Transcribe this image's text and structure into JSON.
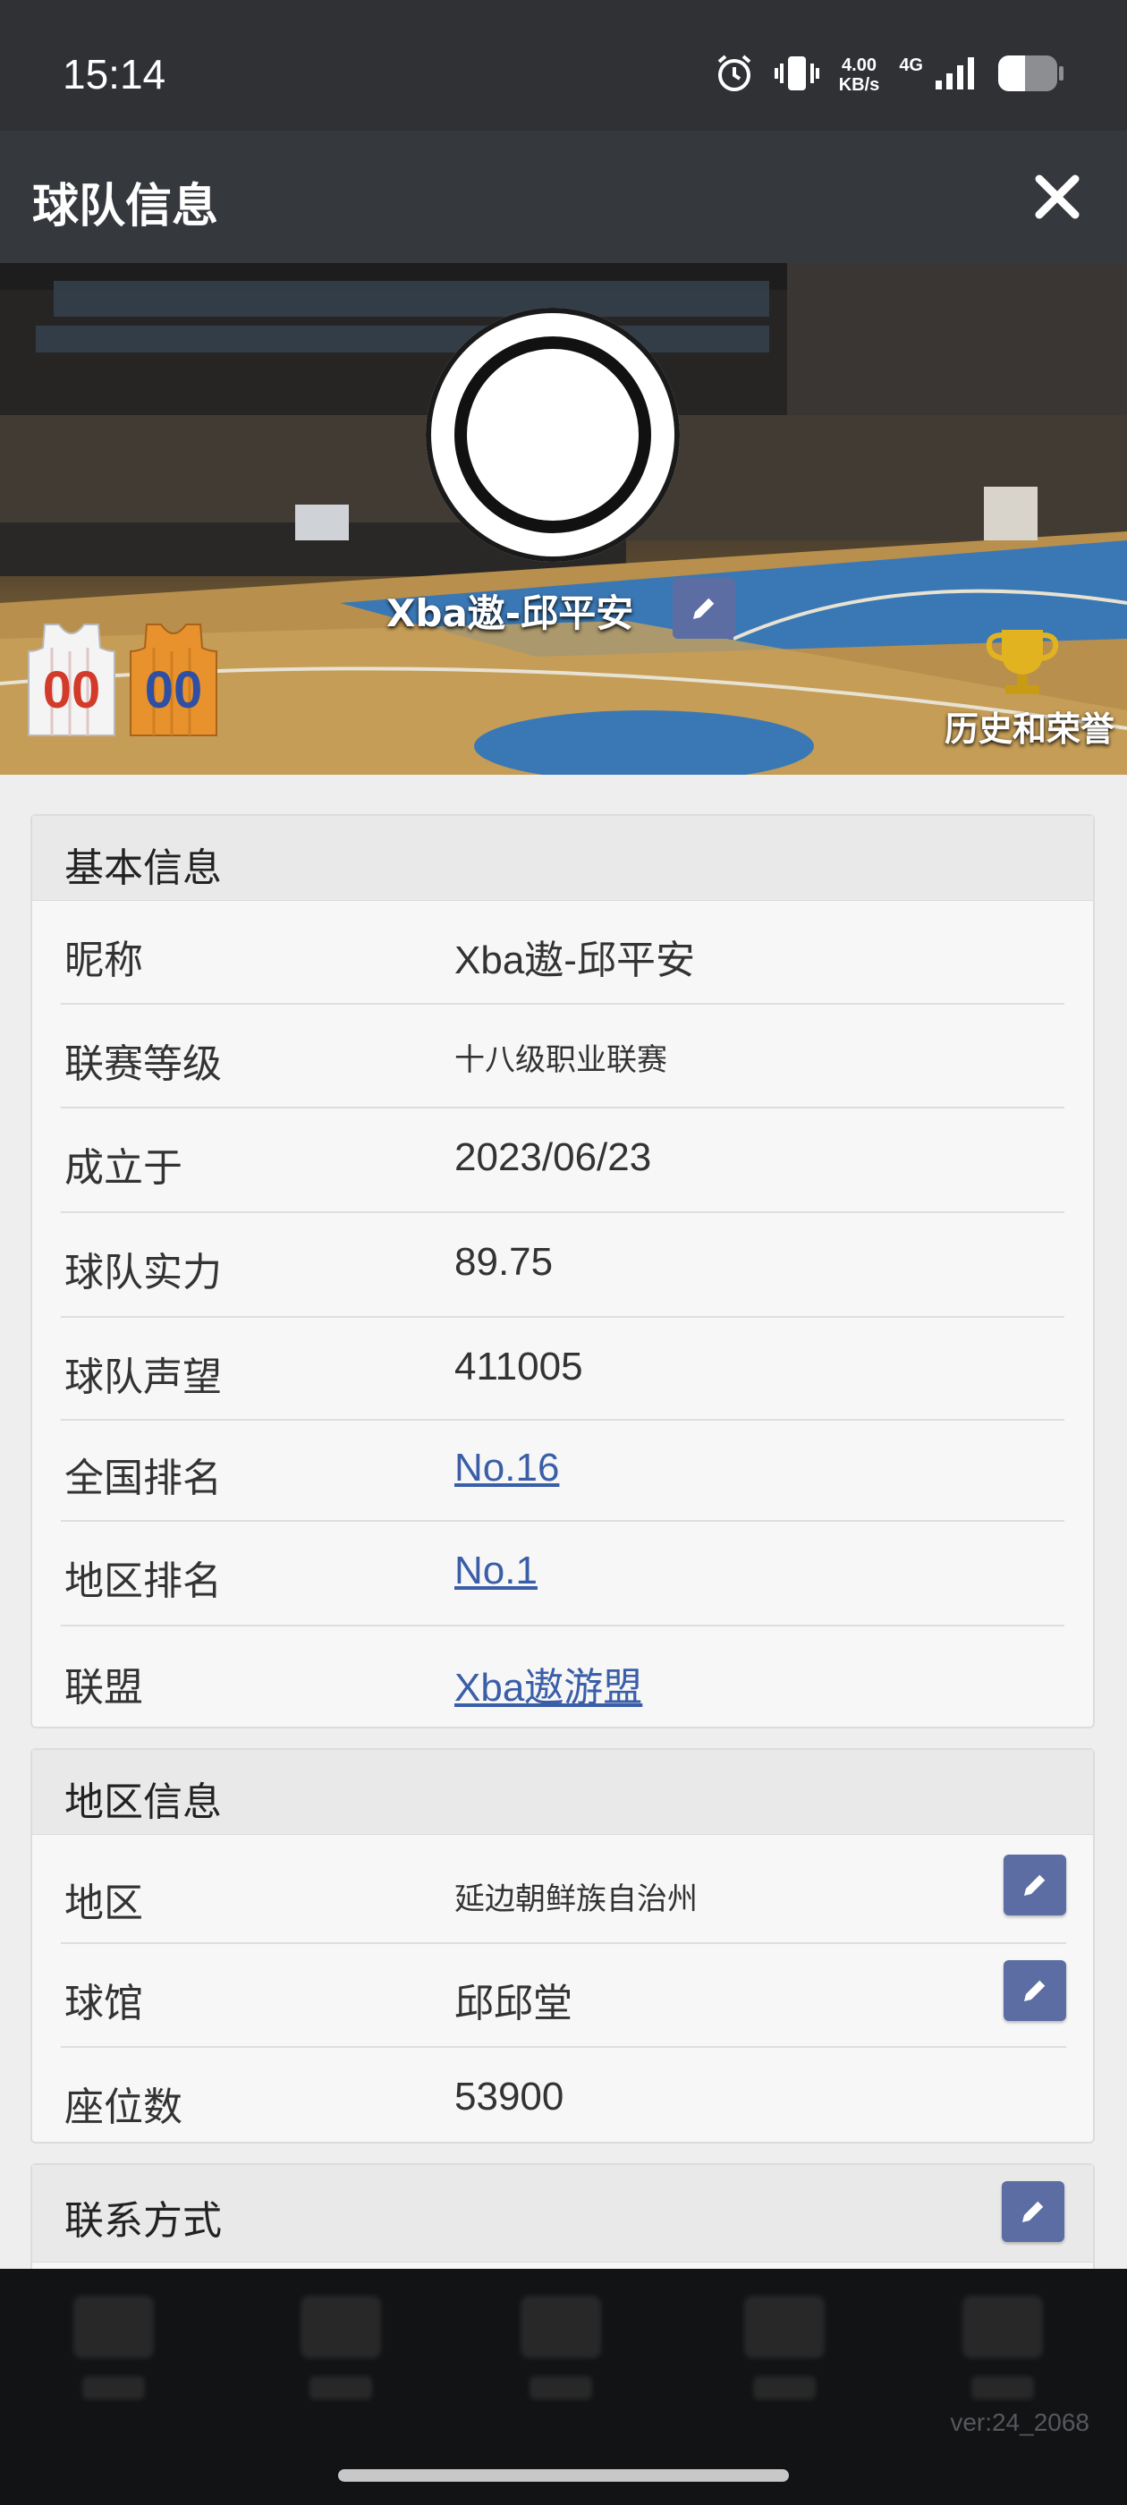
{
  "status_bar": {
    "time": "15:14",
    "speed_value": "4.00",
    "speed_unit": "KB/s",
    "network": "4G",
    "icons": [
      "alarm-icon",
      "vibrate-icon",
      "signal-icon",
      "battery-icon"
    ]
  },
  "header": {
    "title": "球队信息",
    "close_icon": "close-icon"
  },
  "hero": {
    "team_name": "Xba遨-邱平安",
    "jersey_home_number": "00",
    "jersey_away_number": "00",
    "history_label": "历史和荣誉",
    "colors": {
      "jersey_home": "#f4f4f4",
      "jersey_home_digits": "#d23a2a",
      "jersey_away": "#e8922e",
      "jersey_away_digits": "#2f4fa3",
      "trophy": "#e2b321"
    }
  },
  "basic_info": {
    "title": "基本信息",
    "rows": [
      {
        "label": "昵称",
        "value": "Xba遨-邱平安"
      },
      {
        "label": "联赛等级",
        "value": "十八级职业联赛"
      },
      {
        "label": "成立于",
        "value": "2023/06/23"
      },
      {
        "label": "球队实力",
        "value": "89.75"
      },
      {
        "label": "球队声望",
        "value": "411005"
      },
      {
        "label": "全国排名",
        "value": "No.16"
      },
      {
        "label": "地区排名",
        "value": "No.1"
      },
      {
        "label": "联盟",
        "value": "Xba遨游盟"
      }
    ]
  },
  "region_info": {
    "title": "地区信息",
    "rows": [
      {
        "label": "地区",
        "value": "延边朝鲜族自治州"
      },
      {
        "label": "球馆",
        "value": "邱邱堂"
      },
      {
        "label": "座位数",
        "value": "53900"
      }
    ]
  },
  "contact": {
    "title": "联系方式"
  },
  "footer": {
    "version": "ver:24_2068"
  },
  "theme": {
    "edit_button": "#5b6da3",
    "link": "#3a5ea8"
  }
}
